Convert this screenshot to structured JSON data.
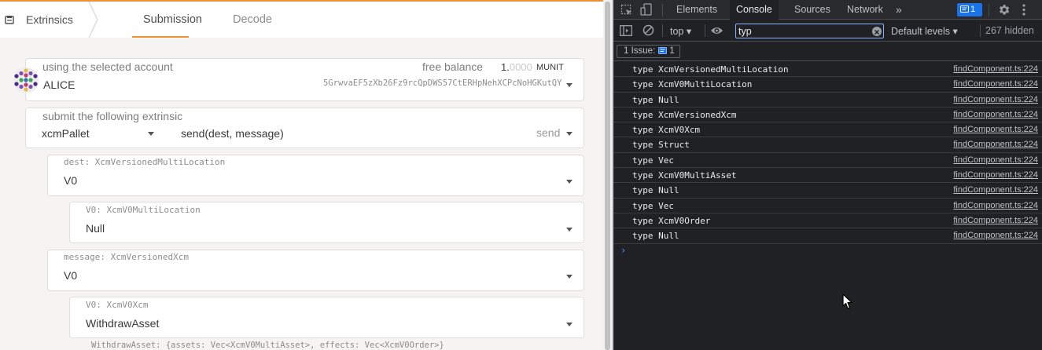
{
  "app": {
    "title": "Extrinsics",
    "tabs": [
      "Submission",
      "Decode"
    ],
    "account": {
      "label": "using the selected account",
      "name": "ALICE",
      "free_balance_label": "free balance",
      "balance_int": "1.",
      "balance_dec": "0000",
      "balance_unit": "MUNIT",
      "address": "5GrwvaEF5zXb26Fz9rcQpDWS57CtERHpNehXCPcNoHGKutQY"
    },
    "extrinsic": {
      "label": "submit the following extrinsic",
      "pallet": "xcmPallet",
      "call": "send(dest, message)",
      "call_name": "send"
    },
    "params": [
      {
        "label": "dest: XcmVersionedMultiLocation",
        "value": "V0"
      },
      {
        "label": "V0: XcmV0MultiLocation",
        "value": "Null"
      },
      {
        "label": "message: XcmVersionedXcm",
        "value": "V0"
      },
      {
        "label": "V0: XcmV0Xcm",
        "value": "WithdrawAsset"
      }
    ],
    "hint": "WithdrawAsset: {assets: Vec<XcmV0MultiAsset>, effects: Vec<XcmV0Order>}"
  },
  "devtools": {
    "tabs": [
      "Elements",
      "Console",
      "Sources",
      "Network"
    ],
    "more_tabs": "»",
    "issues_count": "1",
    "context": "top",
    "filter_value": "typ",
    "levels": "Default levels",
    "hidden": "267 hidden",
    "issues_label": "1 Issue:",
    "issues_button_count": "1",
    "logs": [
      {
        "msg": "type XcmVersionedMultiLocation",
        "src": "findComponent.ts:224"
      },
      {
        "msg": "type XcmV0MultiLocation",
        "src": "findComponent.ts:224"
      },
      {
        "msg": "type Null",
        "src": "findComponent.ts:224"
      },
      {
        "msg": "type XcmVersionedXcm",
        "src": "findComponent.ts:224"
      },
      {
        "msg": "type XcmV0Xcm",
        "src": "findComponent.ts:224"
      },
      {
        "msg": "type Struct",
        "src": "findComponent.ts:224"
      },
      {
        "msg": "type Vec",
        "src": "findComponent.ts:224"
      },
      {
        "msg": "type XcmV0MultiAsset",
        "src": "findComponent.ts:224"
      },
      {
        "msg": "type Null",
        "src": "findComponent.ts:224"
      },
      {
        "msg": "type Vec",
        "src": "findComponent.ts:224"
      },
      {
        "msg": "type XcmV0Order",
        "src": "findComponent.ts:224"
      },
      {
        "msg": "type Null",
        "src": "findComponent.ts:224"
      }
    ],
    "prompt": "›"
  },
  "colors": {
    "accent": "#f19135",
    "devtools_bg": "#202124",
    "devtools_blue": "#1a73e8"
  },
  "icons": {
    "app_logo": "extrinsics-icon",
    "avatar": "identicon",
    "inspect": "inspect-element-icon",
    "device": "device-toolbar-icon",
    "settings": "gear-icon",
    "menu": "kebab-menu-icon",
    "sidebar": "sidebar-toggle-icon",
    "clear": "clear-console-icon",
    "eye": "live-expression-icon"
  }
}
